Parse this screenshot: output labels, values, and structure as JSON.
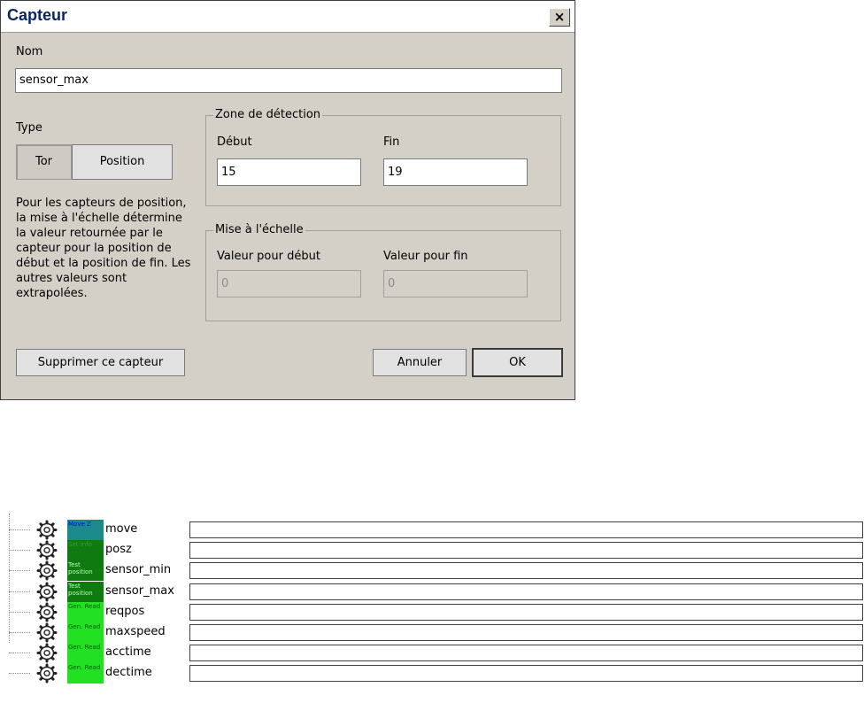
{
  "dialog": {
    "title": "Capteur",
    "close_label": "×",
    "name_label": "Nom",
    "name_value": "sensor_max",
    "type_label": "Type",
    "type_options": [
      "Tor",
      "Position"
    ],
    "description": "Pour les capteurs de position, la mise à l'échelle détermine la valeur retournée par le capteur pour la position de début et la position de fin. Les autres valeurs sont extrapolées.",
    "detection": {
      "legend": "Zone de détection",
      "start_label": "Début",
      "start_value": "15",
      "end_label": "Fin",
      "end_value": "19"
    },
    "scaling": {
      "legend": "Mise à l'échelle",
      "start_label": "Valeur pour début",
      "start_value": "0",
      "end_label": "Valeur pour fin",
      "end_value": "0"
    },
    "delete_button": "Supprimer ce capteur",
    "cancel_button": "Annuler",
    "ok_button": "OK"
  },
  "tree": {
    "items": [
      {
        "tag": "Move Z",
        "tag_color": "#1a8a8a",
        "tag_text_color": "#0000ff",
        "label": "move"
      },
      {
        "tag": "Set Info",
        "tag_color": "#0f7a0f",
        "tag_text_color": "#3d9a3d",
        "label": "posz"
      },
      {
        "tag": "Test position",
        "tag_color": "#0f7a0f",
        "tag_text_color": "#b8ffb8",
        "label": "sensor_min"
      },
      {
        "tag": "Test position",
        "tag_color": "#0f7a0f",
        "tag_text_color": "#b8ffb8",
        "label": "sensor_max"
      },
      {
        "tag": "Gen. Read",
        "tag_color": "#22e022",
        "tag_text_color": "#0a5a0a",
        "label": "reqpos"
      },
      {
        "tag": "Gen. Read",
        "tag_color": "#22e022",
        "tag_text_color": "#0a5a0a",
        "label": "maxspeed"
      },
      {
        "tag": "Gen. Read",
        "tag_color": "#22e022",
        "tag_text_color": "#0a5a0a",
        "label": "acctime"
      },
      {
        "tag": "Gen. Read",
        "tag_color": "#22e022",
        "tag_text_color": "#0a5a0a",
        "label": "dectime"
      }
    ]
  }
}
